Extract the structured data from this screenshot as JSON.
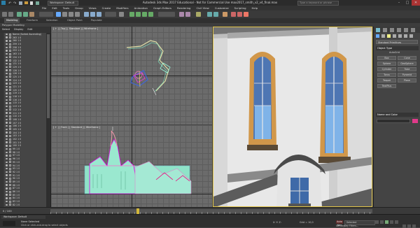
{
  "window": {
    "title": "Autodesk 3ds Max 2017 Educational - Not for Commercial Use   max2017_smith_v2_v4_final.max",
    "workspace": "Workspace: Default",
    "search_placeholder": "Type a keyword or phrase",
    "min": "–",
    "max": "□",
    "close": "✕"
  },
  "menu": [
    "File",
    "Edit",
    "Tools",
    "Group",
    "Views",
    "Create",
    "Modifiers",
    "Animation",
    "Graph Editors",
    "Rendering",
    "Civil View",
    "Customize",
    "Scripting",
    "Help"
  ],
  "ribbon": {
    "tabs": [
      "Modeling",
      "Freeform",
      "Selection",
      "Object Paint",
      "Populate"
    ],
    "active_tab": "Modeling",
    "mode": "Polygon Modeling"
  },
  "scene_explorer": {
    "tabs": [
      "Select",
      "Display",
      "Edit"
    ],
    "items": [
      "Name (Sorted Ascending)",
      "263 1 0",
      "260 1 0",
      "259 1 0",
      "258 1 0",
      "253 1 0",
      "163 1 0",
      "134 1 0",
      "132 1 0",
      "131 1 0",
      "129 1 0",
      "128 1 0",
      "126 1 0",
      "125 1 0",
      "124 1 0",
      "123 1 0",
      "121 1 0",
      "120 1 0",
      "119 1 0",
      "118 1 0",
      "116 1 0",
      "115 1 0",
      "113 1 0",
      "112 1 0",
      "111 1 0",
      "110 1 0",
      "108 1 0",
      "107 1 0",
      "106 1 0",
      "105 1 0",
      "104 1 0",
      "103 1 0",
      "102 1 0",
      "101 1 0",
      "100 1 0",
      "99 1 0",
      "98 1 0",
      "97 1 0",
      "96 1 0",
      "95 1 0",
      "94 1 0",
      "93 1 0",
      "92 1 0",
      "91 1 0",
      "90 1 0",
      "89 1 0",
      "88 1 0",
      "87 1 0",
      "86 1 0",
      "85 1 0",
      "84 1 0",
      "83 1 0",
      "82 1 0"
    ]
  },
  "viewports": {
    "top": "[ + ] [ Top ] [ Standard ] [ Wireframe ]",
    "front": "[ + ] [ Front ] [ Standard ] [ Wireframe ]"
  },
  "command_panel": {
    "dropdown": "Standard Primitives",
    "object_type": "Object Type",
    "autogrid": "AutoGrid",
    "buttons": [
      "Box",
      "Cone",
      "Sphere",
      "GeoSphere",
      "Cylinder",
      "Tube",
      "Torus",
      "Pyramid",
      "Teapot",
      "Plane",
      "TextPlus"
    ],
    "name_and_color": "Name and Color",
    "swatch_color": "#e03a8a"
  },
  "timeslider": {
    "label": "0 / 100"
  },
  "status": {
    "workspace": "Workspace: Default",
    "selection": "None Selected",
    "hint": "Click or click-and-drag to select objects",
    "coords": "X:   Y:   Z:",
    "grid": "Grid = 10,0",
    "autokey": "Auto Key",
    "selected": "Selected",
    "setkey": "Set Key",
    "keyfilters": "Key Filters..."
  },
  "colors": {
    "window_frame": "#d1974a",
    "glass": "#6aa0d8",
    "wall": "#e6e6e6",
    "roof": "#555555",
    "active_border": "#e3c64a"
  }
}
